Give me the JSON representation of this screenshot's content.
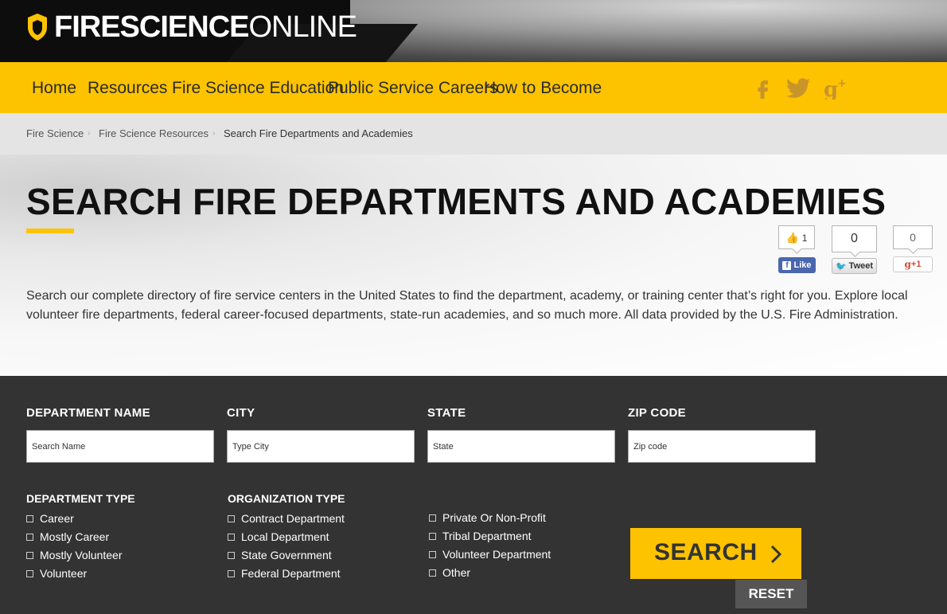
{
  "brand": {
    "bold": "FIRESCIENCE",
    "light": "ONLINE"
  },
  "nav": {
    "items": [
      "Home",
      "Resources",
      "Fire Science Education",
      "Public Service Careers",
      "How to Become"
    ],
    "social": [
      "facebook-icon",
      "twitter-icon",
      "google-plus-icon"
    ]
  },
  "breadcrumb": [
    "Fire Science",
    "Fire Science Resources",
    "Search Fire Departments and Academies"
  ],
  "page": {
    "title": "SEARCH FIRE DEPARTMENTS AND ACADEMIES",
    "description": "Search our complete directory of fire service centers in the United States to find the department, academy, or training center that’s right for you. Explore local volunteer fire departments, federal career-focused departments, state-run academies, and so much more. All data provided by the U.S. Fire Administration."
  },
  "share": {
    "like_count": "1",
    "like_label": "Like",
    "tweet_count": "0",
    "tweet_label": "Tweet",
    "gplus_count": "0",
    "gplus_label": "+1"
  },
  "search": {
    "fields": [
      {
        "label": "DEPARTMENT NAME",
        "placeholder": "Search Name",
        "value": ""
      },
      {
        "label": "CITY",
        "placeholder": "Type City",
        "value": ""
      },
      {
        "label": "STATE",
        "placeholder": "State",
        "value": ""
      },
      {
        "label": "ZIP CODE",
        "placeholder": "Zip code",
        "value": ""
      }
    ],
    "department_type": {
      "label": "DEPARTMENT TYPE",
      "options": [
        "Career",
        "Mostly Career",
        "Mostly Volunteer",
        "Volunteer"
      ]
    },
    "organization_type": {
      "label": "ORGANIZATION TYPE",
      "options": [
        "Contract Department",
        "Local Department",
        "State Government",
        "Federal Department"
      ],
      "options2": [
        "Private Or Non-Profit",
        "Tribal Department",
        "Volunteer Department",
        "Other"
      ]
    },
    "search_label": "SEARCH",
    "reset_label": "RESET"
  },
  "colors": {
    "accent": "#fdc300",
    "dark_panel": "#333333"
  }
}
